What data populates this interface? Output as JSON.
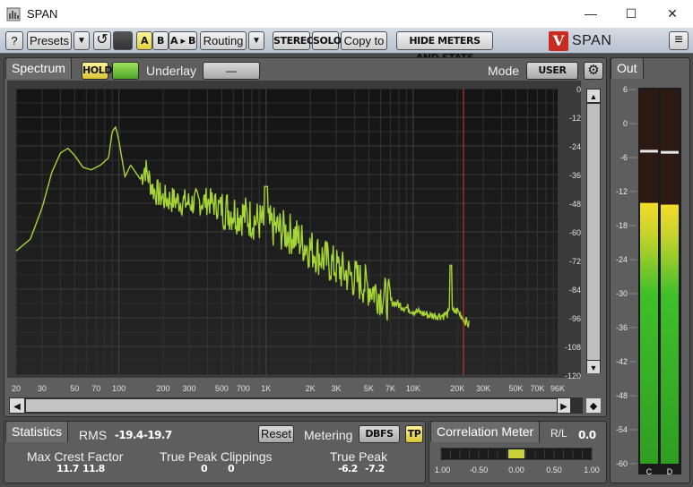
{
  "window": {
    "title": "SPAN",
    "minimize_glyph": "—",
    "maximize_glyph": "☐",
    "close_glyph": "✕"
  },
  "toolbar": {
    "help_label": "?",
    "presets_label": "Presets",
    "presets_dropdown_glyph": "▼",
    "undo_glyph": "↺",
    "a_label": "A",
    "b_label": "B",
    "ab_copy_label": "A ▸ B",
    "routing_label": "Routing",
    "routing_dropdown_glyph": "▼",
    "stereo_label": "STEREO",
    "solo_label": "SOLO",
    "copy_to_label": "Copy to",
    "hide_meters_label": "HIDE METERS AND STATS",
    "brand_logo_letter": "V",
    "brand_name": "SPAN",
    "menu_glyph": "≡"
  },
  "spectrum": {
    "tab_label": "Spectrum",
    "hold_label": "HOLD",
    "underlay_label": "Underlay",
    "underlay_value": "—",
    "mode_label": "Mode",
    "mode_value": "USER",
    "gear_glyph": "⚙",
    "db_ticks": [
      "0",
      "-12",
      "-24",
      "-36",
      "-48",
      "-60",
      "-72",
      "-84",
      "-96",
      "-108",
      "-120"
    ],
    "freq_ticks": [
      "20",
      "30",
      "50",
      "70",
      "100",
      "200",
      "300",
      "500",
      "700",
      "1K",
      "2K",
      "3K",
      "5K",
      "7K",
      "10K",
      "20K",
      "30K",
      "50K",
      "70K",
      "96K"
    ],
    "scroll_left_glyph": "◀",
    "scroll_right_glyph": "▶",
    "scroll_up_glyph": "▲",
    "scroll_down_glyph": "▼",
    "corner_glyph": "◆"
  },
  "statistics": {
    "tab_label": "Statistics",
    "rms_label": "RMS",
    "rms_l": "-19.4",
    "rms_r": "-19.7",
    "reset_label": "Reset",
    "metering_label": "Metering",
    "metering_value": "DBFS",
    "tp_label": "TP",
    "max_crest_label": "Max Crest Factor",
    "max_crest_l": "11.7",
    "max_crest_r": "11.8",
    "tp_clip_label": "True Peak Clippings",
    "tp_clip_l": "0",
    "tp_clip_r": "0",
    "true_peak_label": "True Peak",
    "true_peak_l": "-6.2",
    "true_peak_r": "-7.2"
  },
  "correlation": {
    "tab_label": "Correlation Meter",
    "mode_label": "R/L",
    "value": "0.0",
    "scale": [
      "-1.00",
      "-0.50",
      "0.00",
      "0.50",
      "1.00"
    ]
  },
  "out_meter": {
    "tab_label": "Out",
    "scale": [
      "6",
      "0",
      "-6",
      "-12",
      "-18",
      "-24",
      "-30",
      "-36",
      "-42",
      "-48",
      "-54",
      "-60"
    ],
    "channel_labels": [
      "C",
      "D"
    ],
    "level_l_db": -14.0,
    "level_r_db": -14.3,
    "peak_hold_l_db": -4.8,
    "peak_hold_r_db": -5.0
  },
  "colors": {
    "spectrum_line": "#a6d636",
    "cursor_line": "#e0352b",
    "meter_green": "#3fbf2a",
    "meter_yellow": "#f2dc2a"
  }
}
